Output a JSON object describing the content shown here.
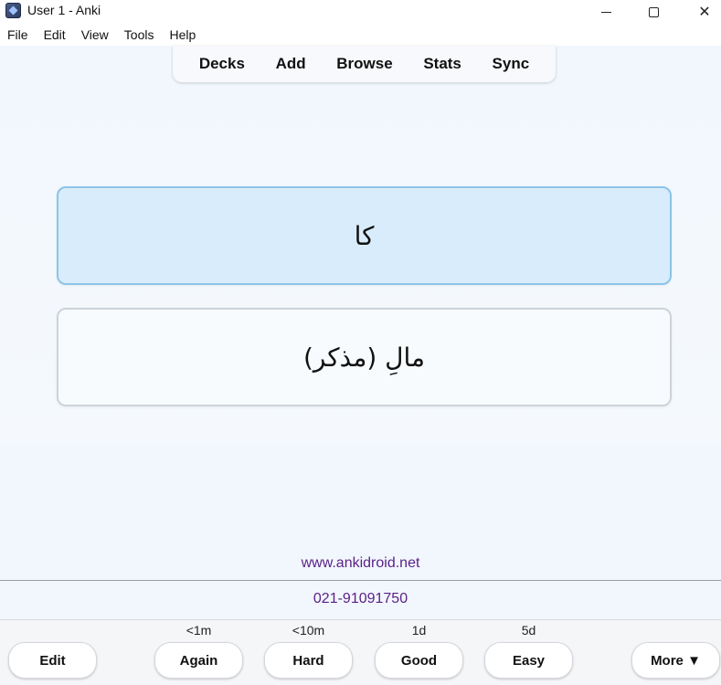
{
  "window": {
    "title": "User 1 - Anki",
    "minimize_icon": "minimize-icon",
    "maximize_icon": "maximize-icon",
    "close_icon": "close-icon",
    "close_glyph": "✕"
  },
  "menu": {
    "items": [
      "File",
      "Edit",
      "View",
      "Tools",
      "Help"
    ]
  },
  "toolbar": {
    "links": [
      "Decks",
      "Add",
      "Browse",
      "Stats",
      "Sync"
    ]
  },
  "card": {
    "front": "کا",
    "back": "مالِ (مذکر)"
  },
  "footer": {
    "website": "www.ankidroid.net",
    "phone": "021-91091750"
  },
  "answer_bar": {
    "edit_label": "Edit",
    "more_label": "More ▼",
    "buttons": [
      {
        "label": "Again",
        "interval": "<1m"
      },
      {
        "label": "Hard",
        "interval": "<10m"
      },
      {
        "label": "Good",
        "interval": "1d"
      },
      {
        "label": "Easy",
        "interval": "5d"
      }
    ]
  },
  "colors": {
    "link_purple": "#5b1f87",
    "front_card_bg": "#d9ecfb",
    "front_card_border": "#8cc4e8"
  }
}
